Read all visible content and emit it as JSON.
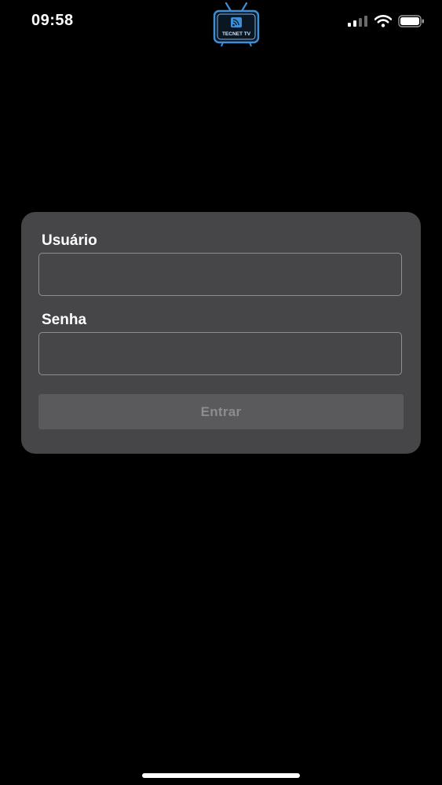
{
  "status_bar": {
    "time": "09:58",
    "icons": [
      "signal-icon",
      "wifi-icon",
      "battery-icon"
    ]
  },
  "logo": {
    "text": "TECNET TV",
    "color": "#3f8fd8"
  },
  "login": {
    "user_label": "Usuário",
    "user_value": "",
    "password_label": "Senha",
    "password_value": "",
    "submit_label": "Entrar"
  },
  "colors": {
    "background": "#000000",
    "card": "#464548",
    "button": "#5a595c",
    "button_text": "#8d8c90",
    "logo_accent": "#3f8fd8"
  }
}
